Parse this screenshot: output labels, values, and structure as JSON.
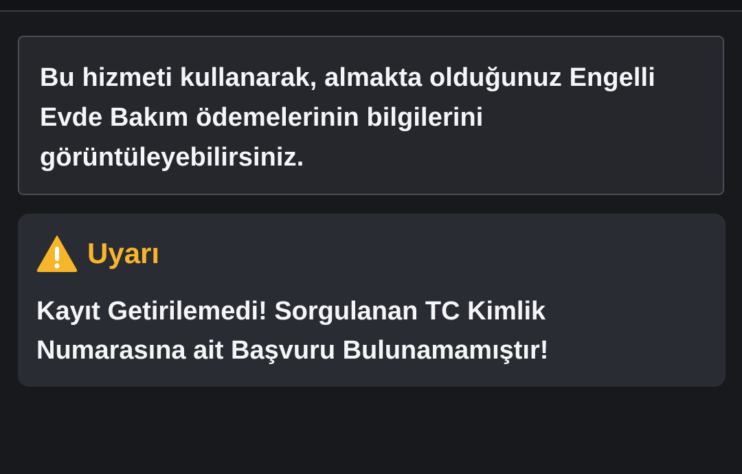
{
  "info": {
    "line1": "Bu hizmeti kullanarak, almakta olduğunuz Engelli",
    "line2": "Evde Bakım ödemelerinin bilgilerini",
    "line3": "görüntüleyebilirsiniz."
  },
  "alert": {
    "icon": "warning-icon",
    "title": "Uyarı",
    "line1": "Kayıt Getirilemedi! Sorgulanan TC Kimlik",
    "line2": "Numarasına ait Başvuru Bulunamamıştır!",
    "accent_color": "#f7b52a"
  },
  "theme": {
    "background": "#18191d",
    "card_background": "#25272d",
    "text_color": "#f4f5f7"
  }
}
